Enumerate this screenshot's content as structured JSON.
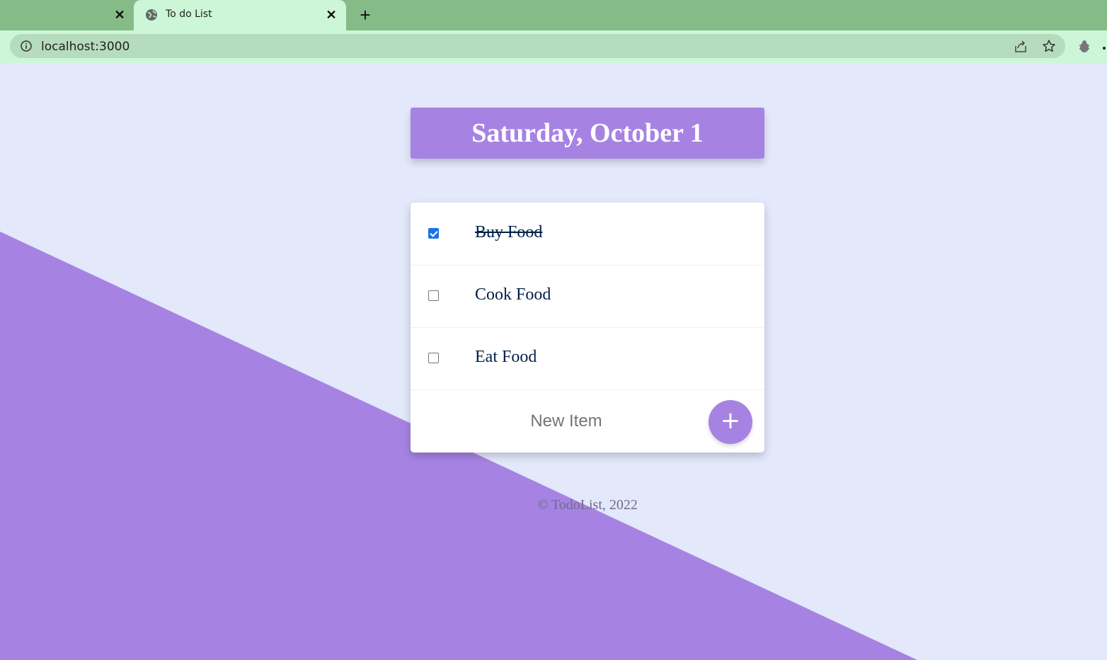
{
  "browser": {
    "tab_title": "To do List",
    "url": "localhost:3000",
    "icons": [
      "close-icon",
      "globe-icon",
      "plus-icon",
      "info-icon",
      "share-icon",
      "star-icon",
      "extension-icon"
    ]
  },
  "page": {
    "heading": "Saturday, October 1",
    "items": [
      {
        "label": "Buy Food",
        "checked": true
      },
      {
        "label": "Cook Food",
        "checked": false
      },
      {
        "label": "Eat Food",
        "checked": false
      }
    ],
    "new_item_placeholder": "New Item",
    "add_button_label": "+",
    "footer": "© TodoList, 2022",
    "colors": {
      "accent": "#a683e3",
      "background": "#e3e8fb",
      "item_text": "#00204a"
    }
  }
}
